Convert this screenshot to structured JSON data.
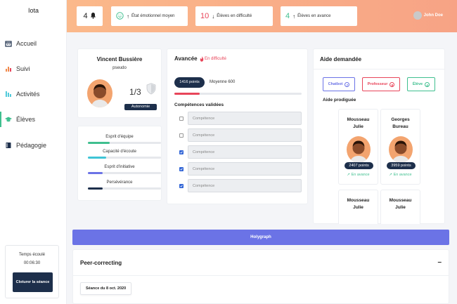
{
  "app": {
    "title": "Iota"
  },
  "sidebar": {
    "items": [
      {
        "label": "Accueil",
        "icon": "calendar-icon"
      },
      {
        "label": "Suivi",
        "icon": "bar-chart-icon"
      },
      {
        "label": "Activités",
        "icon": "activity-icon"
      },
      {
        "label": "Élèves",
        "icon": "graduation-cap-icon"
      },
      {
        "label": "Pédagogie",
        "icon": "book-icon"
      }
    ],
    "active": "Élèves",
    "timer": {
      "label": "Temps écoulé",
      "value": "00:06:30"
    },
    "close_button": "Cloturer la séance"
  },
  "header": {
    "bell_count": "4",
    "emotion_label": "État émotionnel moyen",
    "difficulty_count": "10",
    "difficulty_label": "Élèves en difficulté",
    "advance_count": "4",
    "advance_label": "Élèves en avance",
    "user_name": "John Doe"
  },
  "student": {
    "name": "Vincent Bussière",
    "pseudo": "pseudo",
    "fraction": "1/3",
    "badge": "Autonomie"
  },
  "skills": [
    {
      "label": "Esprit d'équipe",
      "level": 0.3,
      "color": "#3fbf8f"
    },
    {
      "label": "Capacité d'écoute",
      "level": 0.25,
      "color": "#3ec4d6"
    },
    {
      "label": "Esprit d'initiative",
      "level": 0.2,
      "color": "#6b73e6"
    },
    {
      "label": "Persévérance",
      "level": 0.2,
      "color": "#1d2f4b"
    }
  ],
  "progress": {
    "title": "Avancée",
    "status": "En difficulté",
    "points": "1416 points",
    "average": "Moyenne 600",
    "fill": 0.2,
    "competences_title": "Compétences validées",
    "competences": [
      {
        "label": "Compétence",
        "checked": false
      },
      {
        "label": "Compétence",
        "checked": false
      },
      {
        "label": "Compétence",
        "checked": true
      },
      {
        "label": "Compétence",
        "checked": true
      },
      {
        "label": "Compétence",
        "checked": true
      }
    ]
  },
  "help": {
    "title": "Aide demandée",
    "buttons": [
      {
        "label": "Chatbot",
        "count": "7",
        "color": "#6b73e6"
      },
      {
        "label": "Professeur",
        "count": "8",
        "color": "#e8455a"
      },
      {
        "label": "Élève",
        "count": "4",
        "color": "#3fbf8f"
      }
    ],
    "given_title": "Aide prodiguée",
    "helpers": [
      {
        "first": "Mousseau",
        "last": "Julie",
        "points": "2407 points",
        "status": "En avance"
      },
      {
        "first": "Georges",
        "last": "Bureau",
        "points": "3959 points",
        "status": "En avance"
      },
      {
        "first": "Mousseau",
        "last": "Julie"
      },
      {
        "first": "Mousseau",
        "last": "Julie"
      }
    ]
  },
  "holygraph": {
    "label": "Holygraph"
  },
  "peer": {
    "title": "Peer-correcting",
    "collapse": "–",
    "session": "Séance du 8 oct. 2020"
  }
}
